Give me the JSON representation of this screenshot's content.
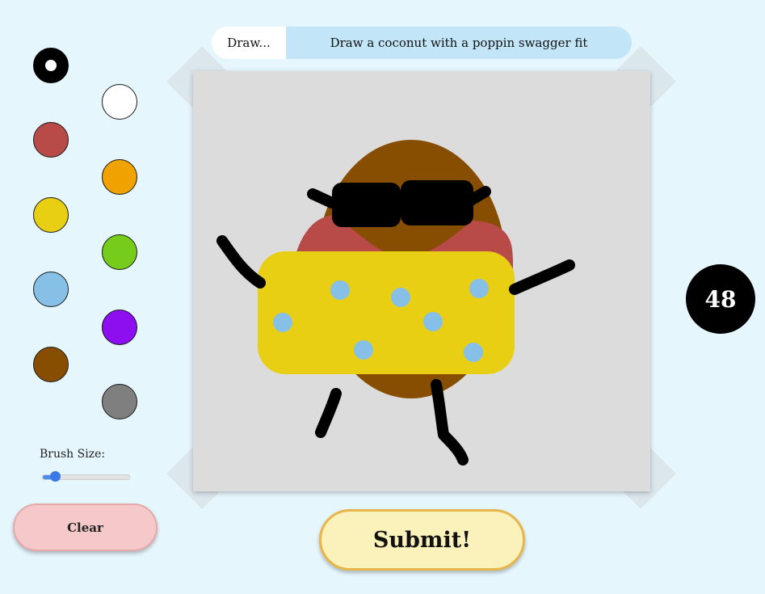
{
  "prompt": {
    "label": "Draw...",
    "text": "Draw a coconut with a poppin swagger fit"
  },
  "palette": [
    {
      "name": "black",
      "hex": "#000000",
      "selected": true
    },
    {
      "name": "white",
      "hex": "#ffffff",
      "selected": false
    },
    {
      "name": "red",
      "hex": "#b84a48",
      "selected": false
    },
    {
      "name": "orange",
      "hex": "#f0a300",
      "selected": false
    },
    {
      "name": "yellow",
      "hex": "#e8cf14",
      "selected": false
    },
    {
      "name": "green",
      "hex": "#75cc1a",
      "selected": false
    },
    {
      "name": "light-blue",
      "hex": "#86c0e6",
      "selected": false
    },
    {
      "name": "purple",
      "hex": "#8d0ff0",
      "selected": false
    },
    {
      "name": "brown",
      "hex": "#874d00",
      "selected": false
    },
    {
      "name": "gray",
      "hex": "#7f7f7f",
      "selected": false
    }
  ],
  "brush": {
    "label": "Brush Size:",
    "value_fraction": 0.14
  },
  "buttons": {
    "clear_label": "Clear",
    "submit_label": "Submit!"
  },
  "timer": {
    "value": "48"
  },
  "colors": {
    "background": "#e6f6fd",
    "canvas": "#dcdcdc",
    "prompt_highlight": "#c2e6f8",
    "submit_fill": "#fbf1bb",
    "submit_border": "#e8b54a",
    "clear_fill": "#f5c9c9"
  }
}
